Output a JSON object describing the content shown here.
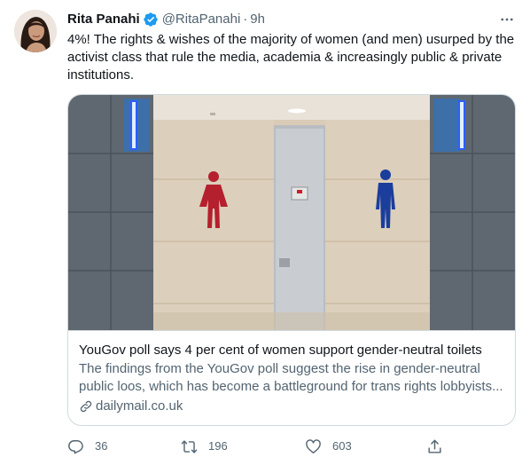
{
  "tweet": {
    "author": {
      "display_name": "Rita Panahi",
      "handle": "@RitaPanahi",
      "verified": true
    },
    "separator": "·",
    "timestamp": "9h",
    "text": "4%! The rights & wishes of the majority of women (and men) usurped by the activist class that rule the media, academia & increasingly public & private institutions.",
    "card": {
      "title": "YouGov poll says 4 per cent of women support gender-neutral toilets",
      "description": "The findings from the YouGov poll suggest the rise in gender-neutral public loos, which has become a battleground for trans rights lobbyists...",
      "domain": "dailymail.co.uk"
    },
    "actions": {
      "reply_count": "36",
      "retweet_count": "196",
      "like_count": "603"
    }
  },
  "icons": {
    "verified": "verified-badge-icon",
    "more": "more-options-icon",
    "link": "link-icon",
    "reply": "reply-icon",
    "retweet": "retweet-icon",
    "like": "like-heart-icon",
    "share": "share-icon"
  },
  "colors": {
    "text_primary": "#0f1419",
    "text_secondary": "#536471",
    "verified_blue": "#1d9bf0",
    "border": "#cfd9de",
    "female_sign": "#b5202e",
    "male_sign": "#1b3e9c"
  }
}
